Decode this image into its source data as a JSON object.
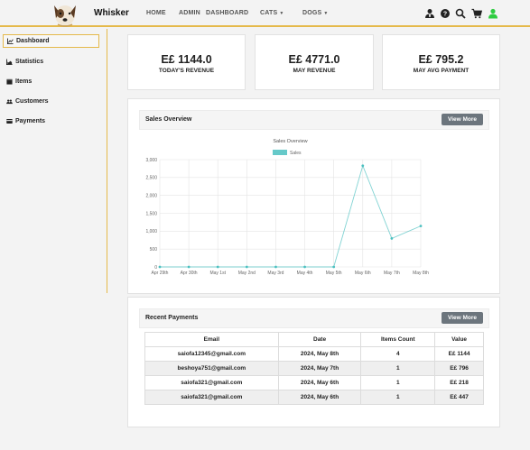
{
  "header": {
    "brand": "Whisker",
    "nav": [
      {
        "label": "HOME",
        "dropdown": false
      },
      {
        "label": "ADMIN",
        "dropdown": false
      },
      {
        "label": "DASHBOARD",
        "dropdown": false
      },
      {
        "label": "CATS",
        "dropdown": true
      },
      {
        "label": "DOGS",
        "dropdown": true
      }
    ],
    "icons": [
      "admin-user-icon",
      "help-icon",
      "search-icon",
      "cart-icon",
      "account-icon"
    ],
    "accent": "#e5b94a",
    "account_color": "#2ecc40"
  },
  "sidebar": {
    "items": [
      {
        "label": "Dashboard",
        "icon": "chart-line-icon",
        "active": true
      },
      {
        "label": "Statistics",
        "icon": "chart-area-icon",
        "active": false
      },
      {
        "label": "Items",
        "icon": "box-icon",
        "active": false
      },
      {
        "label": "Customers",
        "icon": "users-icon",
        "active": false
      },
      {
        "label": "Payments",
        "icon": "credit-card-icon",
        "active": false
      }
    ]
  },
  "stats": [
    {
      "value": "E£ 1144.0",
      "label": "TODAY'S REVENUE"
    },
    {
      "value": "E£ 4771.0",
      "label": "MAY REVENUE"
    },
    {
      "value": "E£ 795.2",
      "label": "MAY AVG PAYMENT"
    }
  ],
  "sales": {
    "title": "Sales Overview",
    "view_more": "View More"
  },
  "chart_data": {
    "type": "line",
    "title": "Sales Overview",
    "series": [
      {
        "name": "Sales",
        "color": "#4bc0c0",
        "values": [
          0,
          0,
          0,
          0,
          0,
          0,
          0,
          2830,
          796,
          1144
        ]
      }
    ],
    "categories": [
      "Apr 29th",
      "Apr 30th",
      "May 1st",
      "May 2nd",
      "May 3rd",
      "May 4th",
      "May 5th",
      "May 6th",
      "May 7th",
      "May 8th"
    ],
    "yticks": [
      "0",
      "500",
      "1,000",
      "1,500",
      "2,000",
      "2,500",
      "3,000"
    ],
    "ylim": [
      0,
      3000
    ],
    "legend": "top",
    "grid": true
  },
  "payments": {
    "title": "Recent Payments",
    "view_more": "View More",
    "columns": [
      "Email",
      "Date",
      "Items Count",
      "Value"
    ],
    "rows": [
      [
        "saiofa12345@gmail.com",
        "2024, May 8th",
        "4",
        "E£ 1144"
      ],
      [
        "beshoya751@gmail.com",
        "2024, May 7th",
        "1",
        "E£ 796"
      ],
      [
        "saiofa321@gmail.com",
        "2024, May 6th",
        "1",
        "E£ 218"
      ],
      [
        "saiofa321@gmail.com",
        "2024, May 6th",
        "1",
        "E£ 447"
      ]
    ]
  }
}
